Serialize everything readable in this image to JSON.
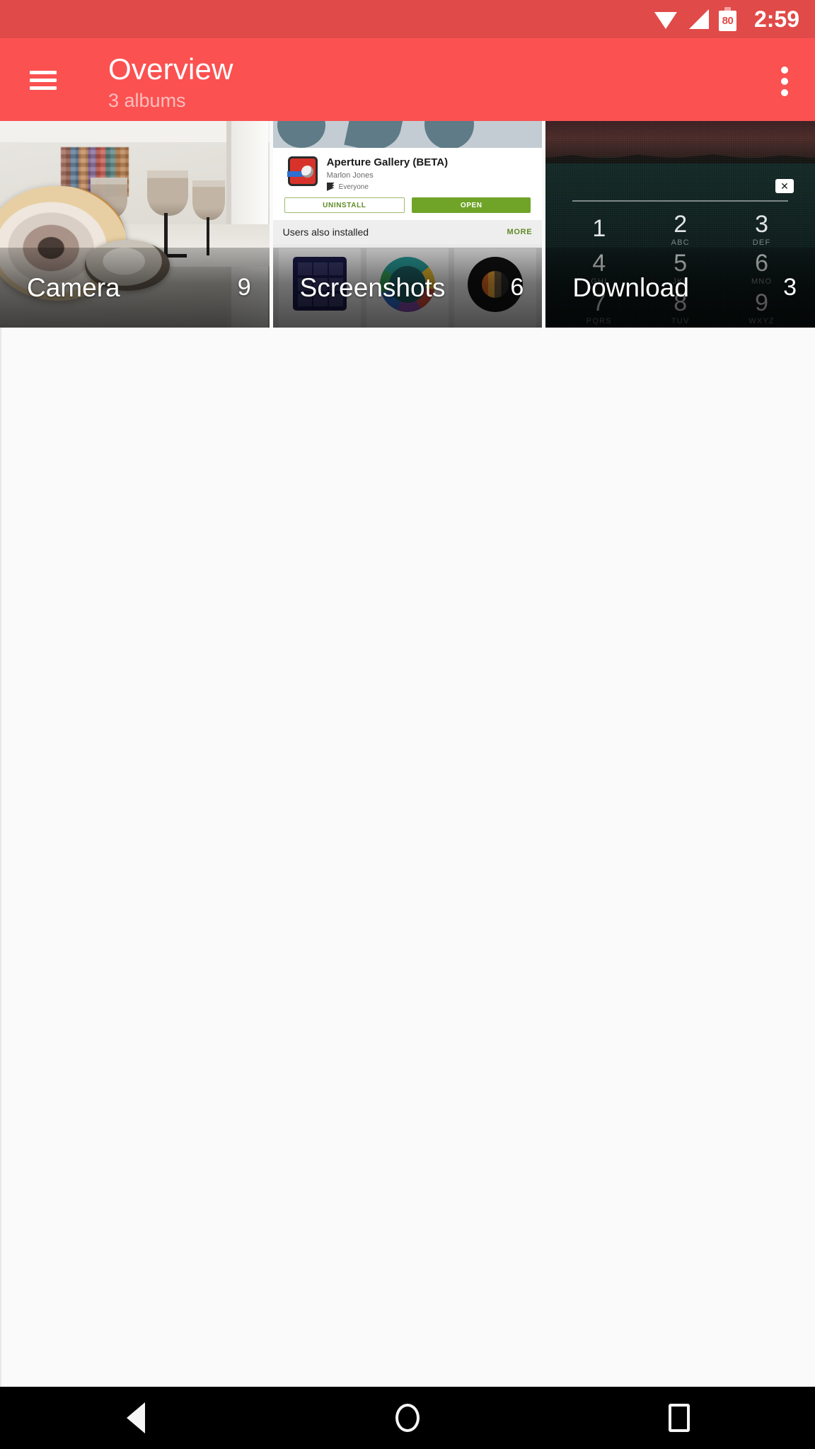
{
  "status_bar": {
    "time": "2:59",
    "battery_level": "80",
    "wifi_icon": "wifi-icon",
    "signal_icon": "signal-icon",
    "battery_icon": "battery-icon",
    "background_color": "#e04a48"
  },
  "toolbar": {
    "menu_icon": "hamburger-menu-icon",
    "title": "Overview",
    "subtitle": "3 albums",
    "overflow_icon": "overflow-menu-icon",
    "background_color": "#fb5151"
  },
  "albums": [
    {
      "name": "Camera",
      "count": "9",
      "thumbnail": "geode-rocks-photo"
    },
    {
      "name": "Screenshots",
      "count": "6",
      "thumbnail": "play-store-screenshot"
    },
    {
      "name": "Download",
      "count": "3",
      "thumbnail": "lockscreen-pin-screenshot"
    }
  ],
  "screenshot_thumb": {
    "app_name": "Aperture Gallery (BETA)",
    "developer": "Marlon Jones",
    "content_rating": "Everyone",
    "uninstall_label": "UNINSTALL",
    "open_label": "OPEN",
    "section_title": "Users also installed",
    "more_label": "MORE",
    "open_button_color": "#6fa428"
  },
  "download_thumb": {
    "clear_glyph": "✕",
    "keys": [
      {
        "digit": "1",
        "letters": ""
      },
      {
        "digit": "2",
        "letters": "ABC"
      },
      {
        "digit": "3",
        "letters": "DEF"
      },
      {
        "digit": "4",
        "letters": "GHI"
      },
      {
        "digit": "5",
        "letters": "JKL"
      },
      {
        "digit": "6",
        "letters": "MNO"
      },
      {
        "digit": "7",
        "letters": "PQRS"
      },
      {
        "digit": "8",
        "letters": "TUV"
      },
      {
        "digit": "9",
        "letters": "WXYZ"
      }
    ]
  },
  "nav_bar": {
    "back_icon": "back-triangle-icon",
    "home_icon": "home-circle-icon",
    "recents_icon": "recents-square-icon"
  }
}
